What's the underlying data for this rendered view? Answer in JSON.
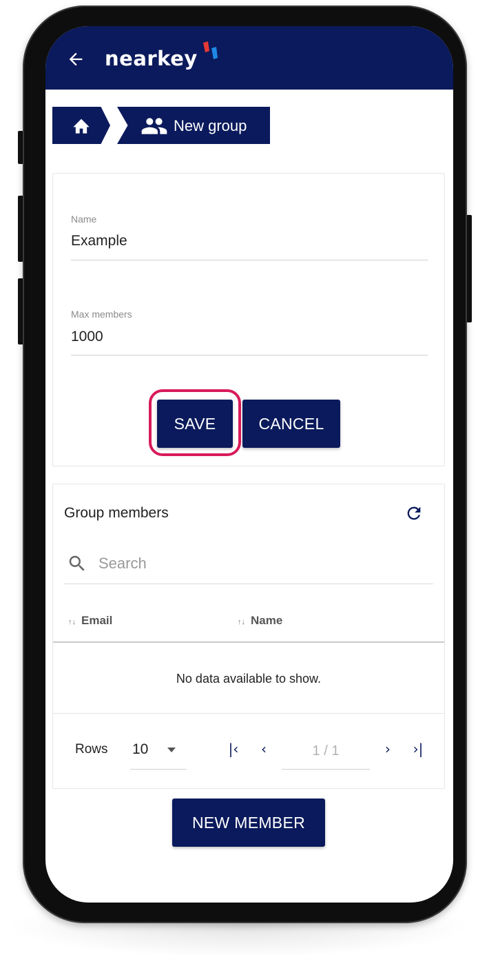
{
  "app": {
    "brand": "nearkey",
    "back_icon": "arrow-left-icon",
    "brand_mark_colors": [
      "#e53935",
      "#1e88e5"
    ]
  },
  "breadcrumb": {
    "home_icon": "home-icon",
    "group_icon": "people-icon",
    "current": "New group"
  },
  "form": {
    "name_label": "Name",
    "name_value": "Example",
    "max_members_label": "Max members",
    "max_members_value": "1000",
    "save_label": "SAVE",
    "cancel_label": "CANCEL"
  },
  "members": {
    "title": "Group members",
    "refresh_icon": "refresh-icon",
    "search_icon": "search-icon",
    "search_placeholder": "Search",
    "columns": [
      "Email",
      "Name"
    ],
    "empty_message": "No data available to show.",
    "rows_label": "Rows",
    "rows_value": "10",
    "page_indicator": "1 / 1"
  },
  "new_member_label": "NEW MEMBER",
  "colors": {
    "primary": "#0b1a5c",
    "highlight": "#d81b5a"
  }
}
